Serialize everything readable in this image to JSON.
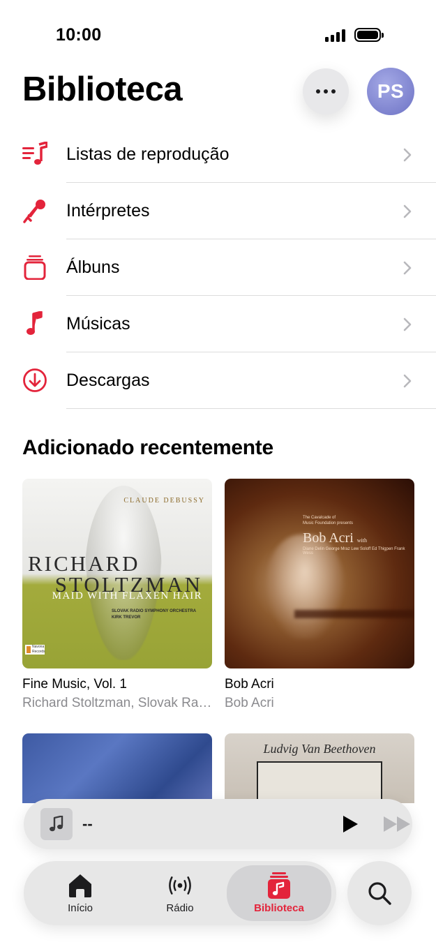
{
  "status_bar": {
    "time": "10:00"
  },
  "header": {
    "title": "Biblioteca",
    "avatar_initials": "PS"
  },
  "accent_color": "#e3243b",
  "menu": [
    {
      "label": "Listas de reprodução",
      "icon": "playlist-icon"
    },
    {
      "label": "Intérpretes",
      "icon": "microphone-icon"
    },
    {
      "label": "Álbuns",
      "icon": "albums-icon"
    },
    {
      "label": "Músicas",
      "icon": "music-note-icon"
    },
    {
      "label": "Descargas",
      "icon": "download-icon"
    }
  ],
  "recently_added": {
    "title": "Adicionado recentemente",
    "albums": [
      {
        "title": "Fine Music, Vol. 1",
        "artist": "Richard Stoltzman, Slovak Radio Symphony Orchestra",
        "cover_text": {
          "composer": "CLAUDE DEBUSSY",
          "name_line1": "RICHARD",
          "name_line2": "STOLTZMAN",
          "subtitle": "MAID WITH FLAXEN HAIR",
          "orchestra_line1": "SLOVAK RADIO SYMPHONY ORCHESTRA",
          "orchestra_line2": "KIRK TREVOR",
          "label_line1": "Navona",
          "label_line2": "Records"
        }
      },
      {
        "title": "Bob Acri",
        "artist": "Bob Acri",
        "cover_text": {
          "presents_line1": "The Cavalcade of",
          "presents_line2": "Music Foundation presents",
          "name": "Bob Acri",
          "with": "with",
          "guests": "Diane Delin George Mraz Lew Soloff Ed Thigpen Frank Wess"
        }
      },
      {
        "title": "",
        "artist": "",
        "cover_text": {}
      },
      {
        "title": "",
        "artist": "",
        "cover_text": {
          "heading": "Ludvig Van Beethoven"
        }
      }
    ]
  },
  "now_playing": {
    "track": "--"
  },
  "tabs": [
    {
      "label": "Início",
      "icon": "home-icon",
      "active": false
    },
    {
      "label": "Rádio",
      "icon": "radio-icon",
      "active": false
    },
    {
      "label": "Biblioteca",
      "icon": "library-icon",
      "active": true
    }
  ]
}
